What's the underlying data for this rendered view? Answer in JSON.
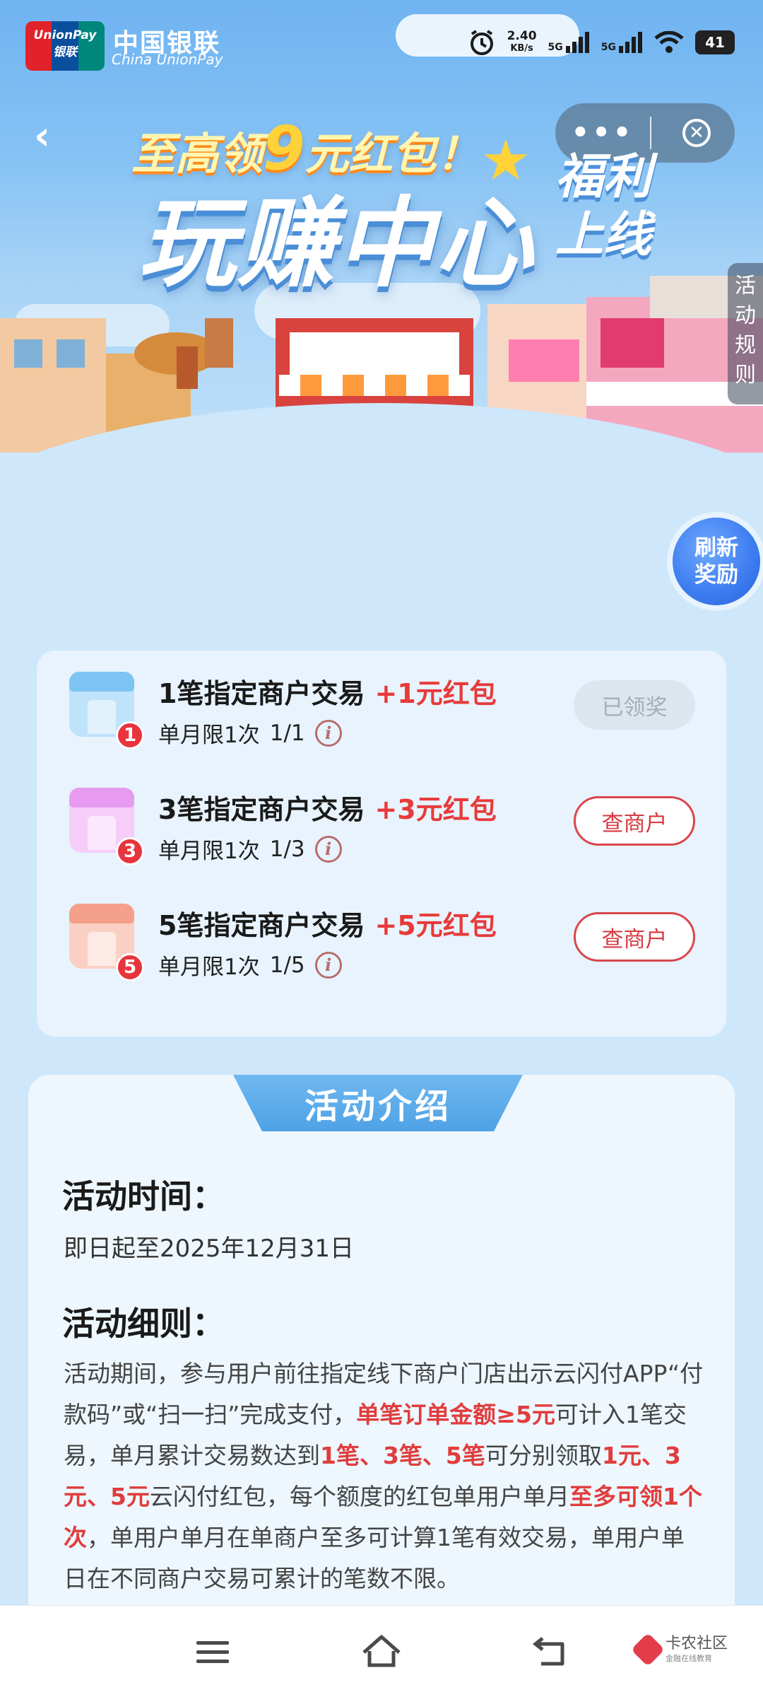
{
  "status_bar": {
    "speed": "2.40",
    "speed_unit": "KB/s",
    "sim1": "5G",
    "sim2": "5G",
    "battery": "41"
  },
  "brand": {
    "logo_top": "UnionPay",
    "logo_bottom": "银联",
    "name_cn": "中国银联",
    "name_en": "China UnionPay"
  },
  "hero": {
    "subtitle_prefix": "至高领",
    "subtitle_number": "9",
    "subtitle_suffix": "元红包！",
    "title": "玩赚中心",
    "welfare": "福利上线"
  },
  "capsule": {
    "more_label": "•••",
    "close_label": "✕"
  },
  "rules_tab": "活动规则",
  "refresh_button": "刷新奖励",
  "tasks": [
    {
      "title": "1笔指定商户交易",
      "reward": "+1元红包",
      "limit": "单月限1次",
      "progress": "1/1",
      "badge": "1",
      "button": "已领奖",
      "button_state": "done",
      "icon_color": "#7cc4f2"
    },
    {
      "title": "3笔指定商户交易",
      "reward": "+3元红包",
      "limit": "单月限1次",
      "progress": "1/3",
      "badge": "3",
      "button": "查商户",
      "button_state": "go",
      "icon_color": "#e79bf0"
    },
    {
      "title": "5笔指定商户交易",
      "reward": "+5元红包",
      "limit": "单月限1次",
      "progress": "1/5",
      "badge": "5",
      "button": "查商户",
      "button_state": "go",
      "icon_color": "#f5a08a"
    }
  ],
  "intro": {
    "tab_title": "活动介绍",
    "time_heading": "活动时间：",
    "time_value": "即日起至2025年12月31日",
    "rules_heading": "活动细则：",
    "rules_p1": "活动期间，参与用户前往指定线下商户门店出示云闪付APP“付款码”或“扫一扫”完成支付，",
    "rules_hl1": "单笔订单金额≥5元",
    "rules_p2": "可计入1笔交易，单月累计交易数达到",
    "rules_hl2": "1笔、3笔、5笔",
    "rules_p3": "可分别领取",
    "rules_hl3": "1元、3元、5元",
    "rules_p4": "云闪付红包，每个额度的红包单用户单月",
    "rules_hl4": "至多可领1个次",
    "rules_p5": "，单用户单月在单商户至多可计算1笔有效交易，单用户单日在不同商户交易可累计的笔数不限。"
  },
  "watermark": {
    "name": "卡农社区",
    "sub": "金融在线教育"
  },
  "colors": {
    "accent_red": "#e83a3a",
    "page_bg": "#cfe7fb",
    "card_bg": "#e8f3fd",
    "tab_blue": "#4fa2e6"
  }
}
